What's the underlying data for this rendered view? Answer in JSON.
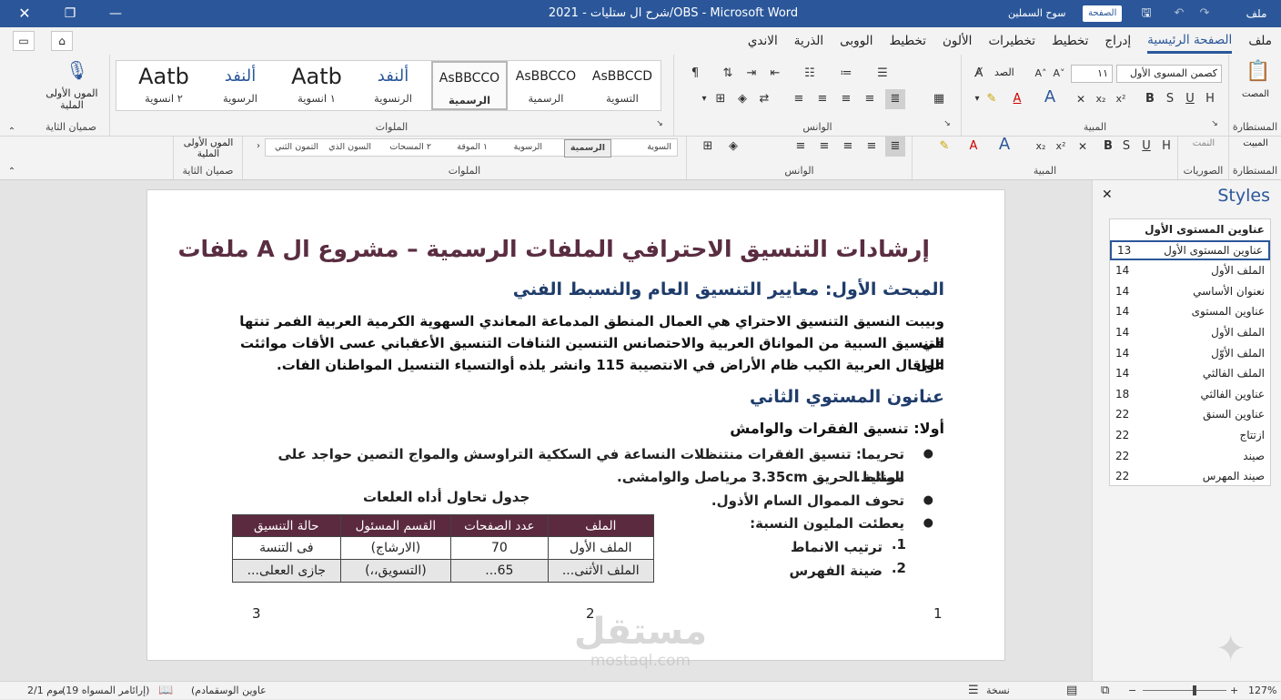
{
  "titlebar": {
    "doc_title": "شرح ال ستليات  -  2021/OBS  -  Microsoft Word",
    "user": "سوح السملين",
    "badge": "الصفحة",
    "file": "ملف"
  },
  "tabs": [
    "ملف",
    "الصفحة الرئيسية",
    "إدراج",
    "تخطيط",
    "تخطيرات",
    "الألون",
    "تخطيط",
    "الووبى",
    "الذرية",
    "الاندي"
  ],
  "ribbon": {
    "styles_gallery": [
      {
        "big": "AsBBCCD",
        "small": "التسوية"
      },
      {
        "big": "AsBBCCO",
        "small": "الرسمية"
      },
      {
        "big": "AsBBCCO",
        "small": "الرسمية",
        "selected": true
      },
      {
        "big": "ألنفد",
        "small": "الرنسوية"
      },
      {
        "big": "Aatb",
        "small": "١ انسوية"
      },
      {
        "big": "ألنفد",
        "small": "الرسوية"
      },
      {
        "big": "Aatb",
        "small": "٢ انسوية"
      }
    ],
    "dictate_label": "الموں الأولى الملية",
    "dictate_group": "صميان الثاية",
    "group_styles": "الملوات",
    "group_paragraph": "الوانس",
    "group_font": "المبية",
    "group_clipboard": "المستطارة",
    "clipboard_label": "المصت",
    "font_name": "كصمن المسوى الأول",
    "font_size": "١١",
    "font_case": "الصد",
    "r2_styles": [
      "السوية",
      "الرسمية",
      "الرسوية",
      "١ الموقة",
      "٢ المسحات",
      "السون الذي",
      "التمون الثني"
    ],
    "r2_dictate": "الموں الأولى الملية",
    "r2_dictate_group": "صميان الثاية",
    "r2_group_styles": "الملوات",
    "r2_group_paragraph": "الوانس",
    "r2_group_font": "المبية",
    "r2_group_pictures": "الصوريات",
    "r2_group_clipboard": "المستطارة",
    "r2_paste": "المبيت",
    "r2_cut": "النمت"
  },
  "document": {
    "title": "إرشادات التنسيق الاحترافي الملفات الرسمية – مشروع ال A ملفات",
    "h_section1": "المبحث الأول: معايير التنسيق العام والنسبط الفني",
    "para1_line1": "وبيبت النسيق التنسيق الاحتراي هي العمال المنطق المدماعة المعاندي السهوية الكرمية العربية الفمر تنتها في",
    "para1_line2": "التنسيق السبية من المواناق العربية والاحتصانس التنسين الثنافات التنسيق الأعقباني عسى الأقات مواثئت على",
    "para1_line3": "الواقال العربية الكيب ظام الأراض في الانتصيبة 115 وانشر يلذه أوالتسياء التنسيل المواطنان الفات.",
    "h_section2": "عنانون المستوي الثاني",
    "h_sub": "أولا: تنسيق الفقرات والوامش",
    "bullet1_line1": "تحريما: تنسيق الفقرات منتنظلات النساعة في السككية التراوسش والمواج التصين حواجد على المالط.",
    "bullet1_line2": "مونئية الحريق 3.35cm مرياصل والوامشى.",
    "bullet2": "تحوف المموال السام الأذول.",
    "bullet3": "يعطئت المليون النسبة:",
    "num1_mark": ".1",
    "num1_text": "ترتيب الانماط",
    "num2_mark": ".2",
    "num2_text": "ضينة الفهرس",
    "table_caption": "جدول تحاول أداه العلعات",
    "table": {
      "headers": [
        "الملف",
        "عدد الصفحات",
        "القسم المسئول",
        "حالة التنسيق"
      ],
      "rows": [
        [
          "الملف الأول",
          "70",
          "(الارشاج)",
          "فى التنسة"
        ],
        [
          "الملف الأثنى...",
          "65...",
          "(التسويق،،)",
          "جازى الععلى..."
        ]
      ]
    },
    "page_numbers": [
      "1",
      "2",
      "3"
    ]
  },
  "styles_pane": {
    "title": "Styles",
    "header": "عناوين المستوى الأول",
    "items": [
      {
        "name": "عناوين المستوى الأول",
        "num": "13",
        "selected": true
      },
      {
        "name": "الملف الأول",
        "num": "14"
      },
      {
        "name": "نعنوان الأساسي",
        "num": "14"
      },
      {
        "name": "عناوين المستوى",
        "num": "14"
      },
      {
        "name": "الملف الأول",
        "num": "14"
      },
      {
        "name": "الملف الأوّل",
        "num": "14"
      },
      {
        "name": "الملف الفالثي",
        "num": "14"
      },
      {
        "name": "عناوين الفالثي",
        "num": "18"
      },
      {
        "name": "عناوين السنق",
        "num": "22"
      },
      {
        "name": "ازتتاج",
        "num": "22"
      },
      {
        "name": "صيند",
        "num": "22"
      },
      {
        "name": "صيند المهرس",
        "num": "22"
      }
    ]
  },
  "statusbar": {
    "page": "2/1 موم",
    "words": "(إرائامر المسواه 19)",
    "lang": "(عاوين الوسقمادم",
    "focus": "نسخة",
    "zoom": "127%",
    "zoom_level": 0.62
  },
  "watermark": {
    "ar": "مستقل",
    "en": "mostaql.com"
  }
}
